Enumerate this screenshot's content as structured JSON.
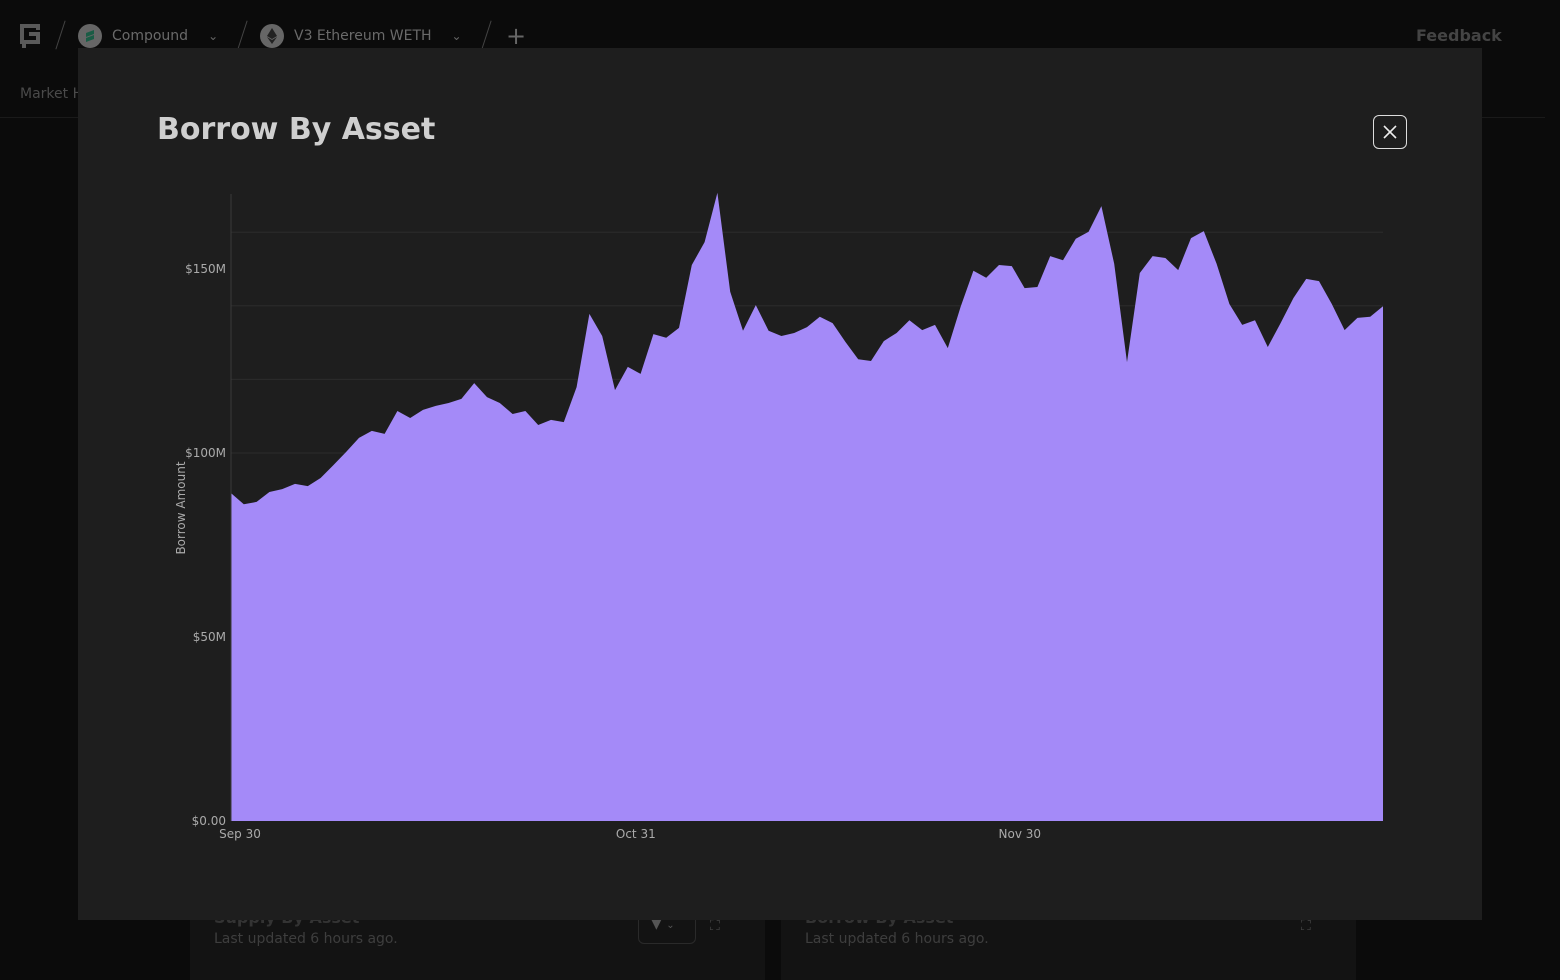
{
  "nav": {
    "crumbs": [
      {
        "label": "Compound",
        "icon": "compound-icon"
      },
      {
        "label": "V3 Ethereum WETH",
        "icon": "ethereum-icon"
      }
    ],
    "feedback": "Feedback",
    "subnav": "Market H"
  },
  "cards": [
    {
      "title": "Supply By Asset",
      "updated": "Last updated 6 hours ago."
    },
    {
      "title": "Borrow By Asset",
      "updated": "Last updated 6 hours ago."
    }
  ],
  "modal": {
    "title": "Borrow By Asset",
    "close_icon": "close-icon"
  },
  "colors": {
    "area": "#a48af8",
    "modal_bg": "#1e1e1e"
  },
  "chart_data": {
    "type": "area",
    "title": "Borrow By Asset",
    "xlabel": "",
    "ylabel": "Borrow Amount",
    "x_start": "Sep 30",
    "x_unit": "day",
    "xticks": [
      {
        "index": 0,
        "label": "Sep 30"
      },
      {
        "index": 31,
        "label": "Oct 31"
      },
      {
        "index": 61,
        "label": "Nov 30"
      }
    ],
    "yticks": [
      {
        "value": 0,
        "label": "$0.00"
      },
      {
        "value": 50,
        "label": "$50M"
      },
      {
        "value": 100,
        "label": "$100M"
      },
      {
        "value": 150,
        "label": "$150M"
      }
    ],
    "gridlines": [
      100,
      120,
      140,
      160
    ],
    "ylim": [
      0,
      170.7
    ],
    "unit": "$M",
    "values": [
      89.1,
      86.1,
      86.7,
      89.4,
      90.2,
      91.6,
      91.0,
      93.2,
      96.7,
      100.3,
      104.1,
      106.0,
      105.2,
      111.4,
      109.5,
      111.7,
      112.8,
      113.6,
      114.7,
      119.0,
      115.2,
      113.6,
      110.6,
      111.4,
      107.6,
      109.0,
      108.4,
      117.9,
      137.8,
      131.8,
      117.1,
      123.4,
      121.5,
      132.3,
      131.3,
      134.0,
      151.1,
      157.3,
      170.7,
      143.8,
      133.2,
      140.2,
      133.2,
      131.8,
      132.6,
      134.2,
      137.0,
      135.3,
      130.2,
      125.5,
      125.0,
      130.4,
      132.6,
      136.1,
      133.4,
      134.8,
      128.5,
      139.7,
      149.5,
      147.6,
      151.1,
      150.8,
      144.8,
      145.1,
      153.5,
      152.4,
      158.2,
      160.1,
      167.1,
      151.4,
      124.7,
      148.9,
      153.5,
      153.0,
      149.7,
      158.4,
      160.3,
      151.4,
      140.5,
      134.8,
      136.1,
      128.8,
      135.3,
      142.1,
      147.3,
      146.7,
      140.5,
      133.4,
      136.7,
      137.0,
      139.9
    ]
  }
}
